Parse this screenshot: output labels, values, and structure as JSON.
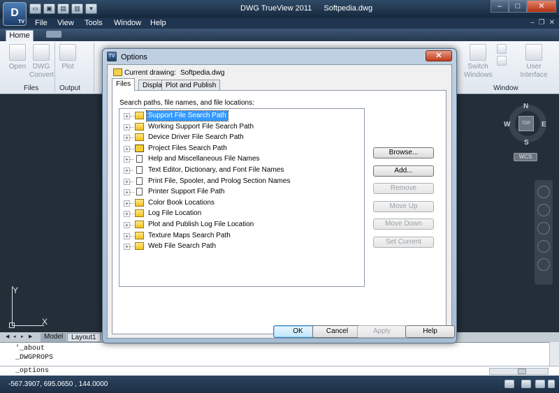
{
  "app": {
    "logo_text": "D",
    "logo_sub": "TV",
    "title": "DWG TrueView 2011",
    "document": "Softpedia.dwg"
  },
  "quick_access": {
    "icons": [
      "open-folder-icon",
      "save-icon",
      "print-icon",
      "printer-icon",
      "dropdown-icon"
    ]
  },
  "window_controls": {
    "minimize": "–",
    "maximize": "□",
    "close": "✕"
  },
  "menu": {
    "items": [
      "File",
      "View",
      "Tools",
      "Window",
      "Help"
    ]
  },
  "ribbon": {
    "tab_home": "Home",
    "buttons": {
      "open": "Open",
      "dwg_convert": [
        "DWG",
        "Convert"
      ],
      "plot": "Plot",
      "switch_windows": [
        "Switch",
        "Windows"
      ],
      "user_interface": [
        "User",
        "Interface"
      ]
    },
    "panels": {
      "files": "Files",
      "output": "Output",
      "window": "Window"
    }
  },
  "viewcube": {
    "top": "TOP",
    "n": "N",
    "s": "S",
    "e": "E",
    "w": "W",
    "wcs": "WCS"
  },
  "ucs": {
    "x": "X",
    "y": "Y"
  },
  "layout_tabs": {
    "model": "Model",
    "layout1": "Layout1"
  },
  "command": {
    "history": [
      "'_about",
      "_DWGPROPS"
    ],
    "input": "_options"
  },
  "status": {
    "coords": "-567.3907, 695.0650 , 144.0000"
  },
  "dialog": {
    "title": "Options",
    "icon_text": "TV",
    "close": "✕",
    "current_drawing_label": "Current drawing:",
    "current_drawing_value": "Softpedia.dwg",
    "tabs": [
      "Files",
      "Display",
      "Plot and Publish"
    ],
    "tree_caption": "Search paths, file names, and file locations:",
    "tree_items": [
      {
        "label": "Support File Search Path",
        "icon": "folder",
        "selected": true
      },
      {
        "label": "Working Support File Search Path",
        "icon": "folder",
        "selected": false
      },
      {
        "label": "Device Driver File Search Path",
        "icon": "folder",
        "selected": false
      },
      {
        "label": "Project Files Search Path",
        "icon": "proj",
        "selected": false
      },
      {
        "label": "Help and Miscellaneous File Names",
        "icon": "doc",
        "selected": false
      },
      {
        "label": "Text Editor, Dictionary, and Font File Names",
        "icon": "doc",
        "selected": false
      },
      {
        "label": "Print File, Spooler, and Prolog Section Names",
        "icon": "doc",
        "selected": false
      },
      {
        "label": "Printer Support File Path",
        "icon": "doc",
        "selected": false
      },
      {
        "label": "Color Book Locations",
        "icon": "folder",
        "selected": false
      },
      {
        "label": "Log File Location",
        "icon": "folder",
        "selected": false
      },
      {
        "label": "Plot and Publish Log File Location",
        "icon": "folder",
        "selected": false
      },
      {
        "label": "Texture Maps Search Path",
        "icon": "folder",
        "selected": false
      },
      {
        "label": "Web File Search Path",
        "icon": "folder",
        "selected": false
      }
    ],
    "side_buttons": [
      {
        "label": "Browse...",
        "enabled": true
      },
      {
        "label": "Add...",
        "enabled": true
      },
      {
        "label": "Remove",
        "enabled": false
      },
      {
        "label": "Move Up",
        "enabled": false
      },
      {
        "label": "Move Down",
        "enabled": false
      },
      {
        "label": "Set Current",
        "enabled": false
      }
    ],
    "ok": "OK",
    "cancel": "Cancel",
    "apply": "Apply",
    "help": "Help"
  }
}
